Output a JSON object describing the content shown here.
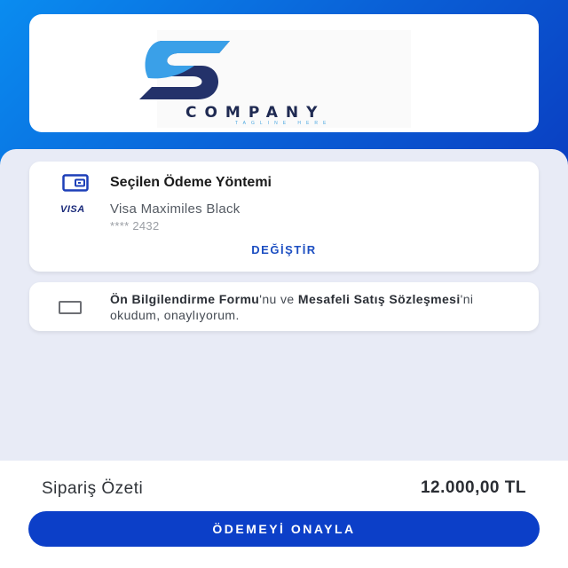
{
  "brand": {
    "name": "COMPANY",
    "tagline": "TAGLINE HERE",
    "colors": {
      "dark": "#1f2a52",
      "light": "#4aa6e0"
    }
  },
  "payment_method": {
    "title": "Seçilen Ödeme Yöntemi",
    "icon": "wallet-icon",
    "network": "VISA",
    "card_name": "Visa Maximiles Black",
    "card_number": "**** 2432",
    "change_label": "DEĞİŞTİR"
  },
  "agreement": {
    "checked": false,
    "part1_bold": "Ön Bilgilendirme Formu",
    "part2": "'nu ve ",
    "part3_bold": "Mesafeli Satış Sözleşmesi",
    "part4": "'ni okudum, onaylıyorum."
  },
  "summary": {
    "label": "Sipariş Özeti",
    "total": "12.000,00 TL"
  },
  "confirm": {
    "label": "ÖDEMEYİ ONAYLA"
  },
  "colors": {
    "accent": "#0c3fc8",
    "header_start": "#0a8cf0",
    "header_end": "#0a3fc2",
    "background": "#e8ebf6"
  }
}
